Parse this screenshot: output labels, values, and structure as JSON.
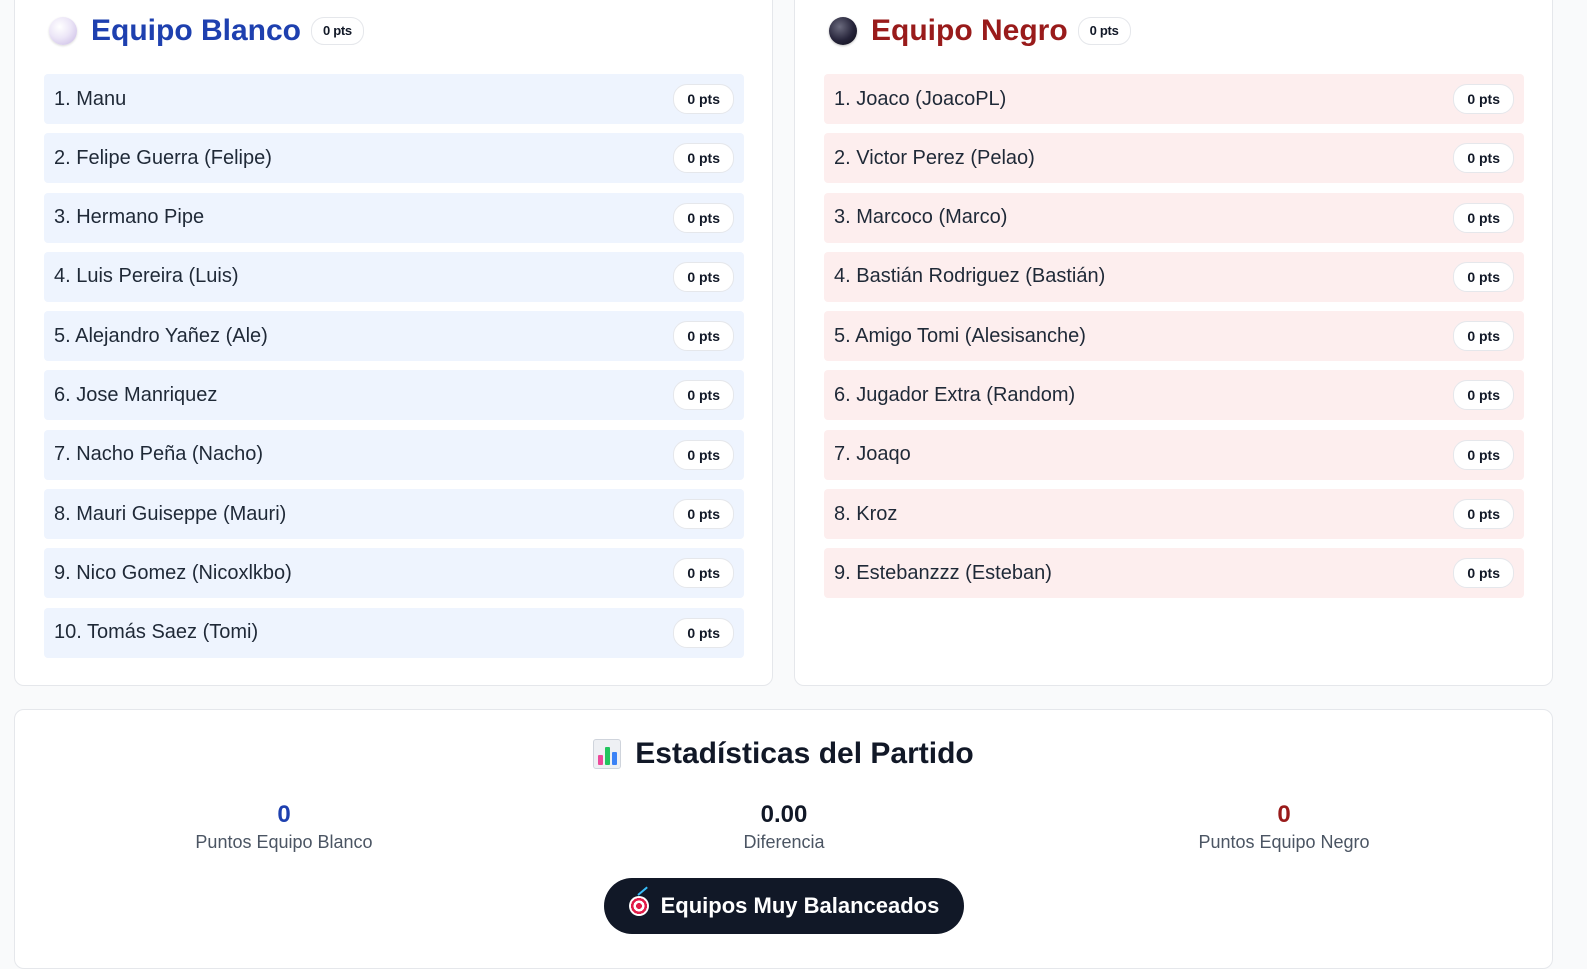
{
  "teams": {
    "white": {
      "name": "Equipo Blanco",
      "total": "0 pts",
      "color": "#1e40af",
      "row_color": "#eef4fe",
      "players": [
        {
          "name": "1. Manu",
          "pts": "0 pts"
        },
        {
          "name": "2. Felipe Guerra (Felipe)",
          "pts": "0 pts"
        },
        {
          "name": "3. Hermano Pipe",
          "pts": "0 pts"
        },
        {
          "name": "4. Luis Pereira (Luis)",
          "pts": "0 pts"
        },
        {
          "name": "5. Alejandro Yañez (Ale)",
          "pts": "0 pts"
        },
        {
          "name": "6. Jose Manriquez",
          "pts": "0 pts"
        },
        {
          "name": "7. Nacho Peña (Nacho)",
          "pts": "0 pts"
        },
        {
          "name": "8. Mauri Guiseppe (Mauri)",
          "pts": "0 pts"
        },
        {
          "name": "9. Nico Gomez (Nicoxlkbo)",
          "pts": "0 pts"
        },
        {
          "name": "10. Tomás Saez (Tomi)",
          "pts": "0 pts"
        }
      ]
    },
    "black": {
      "name": "Equipo Negro",
      "total": "0 pts",
      "color": "#991b1b",
      "row_color": "#fdeeee",
      "players": [
        {
          "name": "1. Joaco (JoacoPL)",
          "pts": "0 pts"
        },
        {
          "name": "2. Victor Perez (Pelao)",
          "pts": "0 pts"
        },
        {
          "name": "3. Marcoco (Marco)",
          "pts": "0 pts"
        },
        {
          "name": "4. Bastián Rodriguez (Bastián)",
          "pts": "0 pts"
        },
        {
          "name": "5. Amigo Tomi (Alesisanche)",
          "pts": "0 pts"
        },
        {
          "name": "6. Jugador Extra (Random)",
          "pts": "0 pts"
        },
        {
          "name": "7. Joaqo",
          "pts": "0 pts"
        },
        {
          "name": "8. Kroz",
          "pts": "0 pts"
        },
        {
          "name": "9. Estebanzzz (Esteban)",
          "pts": "0 pts"
        }
      ]
    }
  },
  "stats": {
    "icon": "bar-chart-icon",
    "title": "Estadísticas del Partido",
    "white_points": {
      "value": "0",
      "label": "Puntos Equipo Blanco",
      "color": "#1e40af"
    },
    "difference": {
      "value": "0.00",
      "label": "Diferencia",
      "color": "#111827"
    },
    "black_points": {
      "value": "0",
      "label": "Puntos Equipo Negro",
      "color": "#991b1b"
    },
    "balance_badge": {
      "icon": "target-icon",
      "label": "Equipos Muy Balanceados",
      "background": "#111827"
    }
  }
}
